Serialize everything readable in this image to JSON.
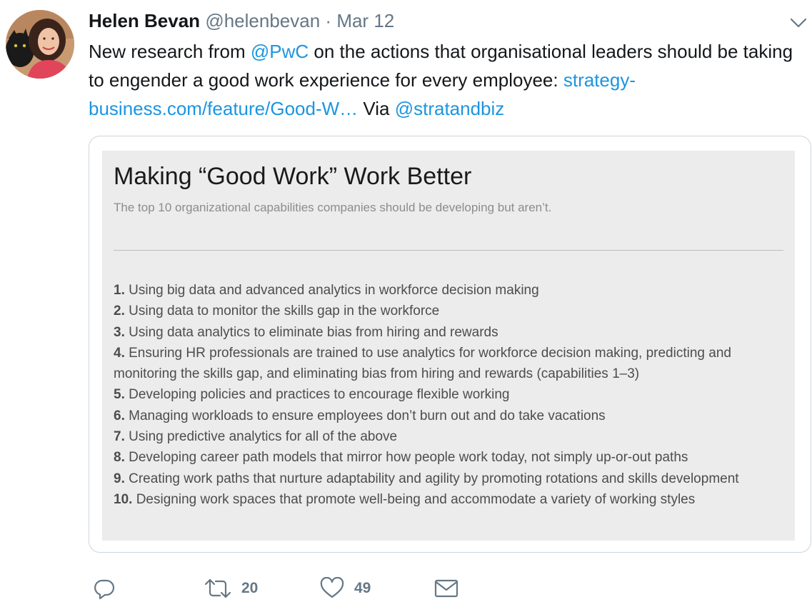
{
  "tweet": {
    "author": {
      "name": "Helen Bevan",
      "handle": "@helenbevan",
      "avatar_icon": "profile-photo"
    },
    "separator": "·",
    "date": "Mar 12",
    "text": {
      "part1": "New research from ",
      "mention1": "@PwC",
      "part2": " on the actions that organisational leaders should be taking to engender a good work experience for every employee: ",
      "url": "strategy-business.com/feature/Good-W…",
      "part3": " Via ",
      "mention2": "@stratandbiz"
    },
    "link_color": "#1b95e0"
  },
  "card": {
    "title": "Making “Good Work” Work Better",
    "subtitle": "The top 10 organizational capabilities companies should be developing but aren’t.",
    "items": [
      {
        "num": "1.",
        "text": " Using big data and advanced analytics in workforce decision making"
      },
      {
        "num": "2.",
        "text": " Using data to monitor the skills gap in the workforce"
      },
      {
        "num": "3.",
        "text": " Using data analytics to eliminate bias from hiring and rewards"
      },
      {
        "num": "4.",
        "text": " Ensuring HR professionals are trained to use analytics for workforce decision making, predicting and monitoring the skills gap, and eliminating bias from hiring and rewards (capabilities 1–3)"
      },
      {
        "num": "5.",
        "text": " Developing policies and practices to encourage flexible working"
      },
      {
        "num": "6.",
        "text": " Managing workloads to ensure employees don’t burn out and do take vacations"
      },
      {
        "num": "7.",
        "text": " Using predictive analytics for all of the above"
      },
      {
        "num": "8.",
        "text": " Developing career path models that mirror how people work today, not simply up-or-out paths"
      },
      {
        "num": "9.",
        "text": " Creating work paths that nurture adaptability and agility by promoting rotations and skills development"
      },
      {
        "num": "10.",
        "text": " Designing work spaces that promote well-being and accommodate a variety of working styles"
      }
    ],
    "background_color": "#ececec"
  },
  "actions": {
    "reply_icon": "reply-icon",
    "retweet_icon": "retweet-icon",
    "retweet_count": "20",
    "like_icon": "heart-icon",
    "like_count": "49",
    "dm_icon": "envelope-icon"
  }
}
